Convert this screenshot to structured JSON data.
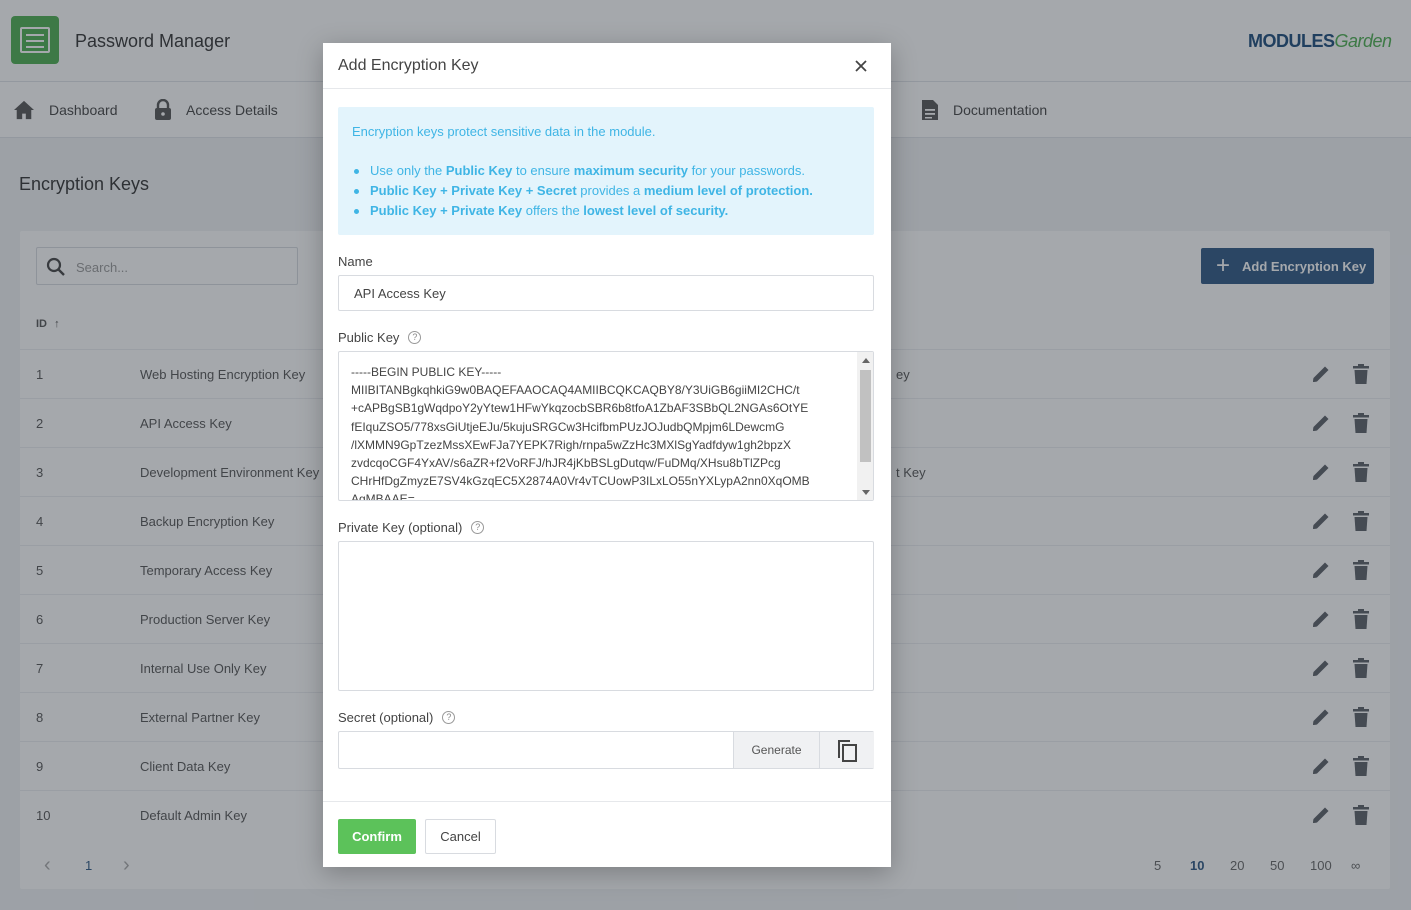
{
  "app": {
    "title": "Password Manager",
    "brand_main": "MODULES",
    "brand_accent": "Garden"
  },
  "nav": {
    "items": [
      {
        "label": "Dashboard",
        "icon": "home-icon"
      },
      {
        "label": "Access Details",
        "icon": "lock-icon"
      },
      {
        "label": "Documentation",
        "icon": "document-icon"
      }
    ]
  },
  "page": {
    "title": "Encryption Keys",
    "search_placeholder": "Search...",
    "add_button": "Add Encryption Key",
    "id_header": "ID",
    "sort_indicator": "↑",
    "rows": [
      {
        "id": "1",
        "name": "Web Hosting Encryption Key",
        "tail": "ey"
      },
      {
        "id": "2",
        "name": "API Access Key",
        "tail": ""
      },
      {
        "id": "3",
        "name": "Development Environment Key",
        "tail": "t Key"
      },
      {
        "id": "4",
        "name": "Backup Encryption Key",
        "tail": ""
      },
      {
        "id": "5",
        "name": "Temporary Access Key",
        "tail": ""
      },
      {
        "id": "6",
        "name": "Production Server Key",
        "tail": ""
      },
      {
        "id": "7",
        "name": "Internal Use Only Key",
        "tail": ""
      },
      {
        "id": "8",
        "name": "External Partner Key",
        "tail": ""
      },
      {
        "id": "9",
        "name": "Client Data Key",
        "tail": ""
      },
      {
        "id": "10",
        "name": "Default Admin Key",
        "tail": ""
      }
    ],
    "pagination": {
      "prev": "‹",
      "current": "1",
      "next": "›",
      "page_sizes": [
        "5",
        "10",
        "20",
        "50",
        "100",
        "∞"
      ],
      "active_size": "10"
    }
  },
  "modal": {
    "title": "Add Encryption Key",
    "alert": {
      "intro": "Encryption keys protect sensitive data in the module.",
      "bullet1": {
        "a": "Use only the ",
        "b": "Public Key",
        "c": " to ensure ",
        "d": "maximum security",
        "e": " for your passwords."
      },
      "bullet2": {
        "a": "Public Key + Private Key + Secret",
        "b": " provides a ",
        "c": "medium level of protection."
      },
      "bullet3": {
        "a": "Public Key + Private Key",
        "b": " offers the ",
        "c": "lowest level of security."
      }
    },
    "name_label": "Name",
    "name_value": "API Access Key",
    "public_key_label": "Public Key",
    "public_key_value": "-----BEGIN PUBLIC KEY-----\nMIIBITANBgkqhkiG9w0BAQEFAAOCAQ4AMIIBCQKCAQBY8/Y3UiGB6giiMI2CHC/t\n+cAPBgSB1gWqdpoY2yYtew1HFwYkqzocbSBR6b8tfoA1ZbAF3SBbQL2NGAs6OtYE\nfEIquZSO5/778xsGiUtjeEJu/5kujuSRGCw3HcifbmPUzJOJudbQMpjm6LDewcmG\n/lXMMN9GpTzezMssXEwFJa7YEPK7Righ/rnpa5wZzHc3MXlSgYadfdyw1gh2bpzX\nzvdcqoCGF4YxAV/s6aZR+f2VoRFJ/hJR4jKbBSLgDutqw/FuDMq/XHsu8bTlZPcg\nCHrHfDgZmyzE7SV4kGzqEC5X2874A0Vr4vTCUowP3ILxLO55nYXLypA2nn0XqOMB\nAgMBAAE=",
    "private_key_label": "Private Key (optional)",
    "private_key_value": "",
    "secret_label": "Secret (optional)",
    "secret_value": "",
    "generate_button": "Generate",
    "confirm_button": "Confirm",
    "cancel_button": "Cancel",
    "help_glyph": "?"
  },
  "colors": {
    "accent_green": "#5cc25a",
    "primary_blue": "#2d5784",
    "info_text": "#3fb5e5",
    "info_bg": "#e3f4fc",
    "active_page": "#2d5784"
  }
}
